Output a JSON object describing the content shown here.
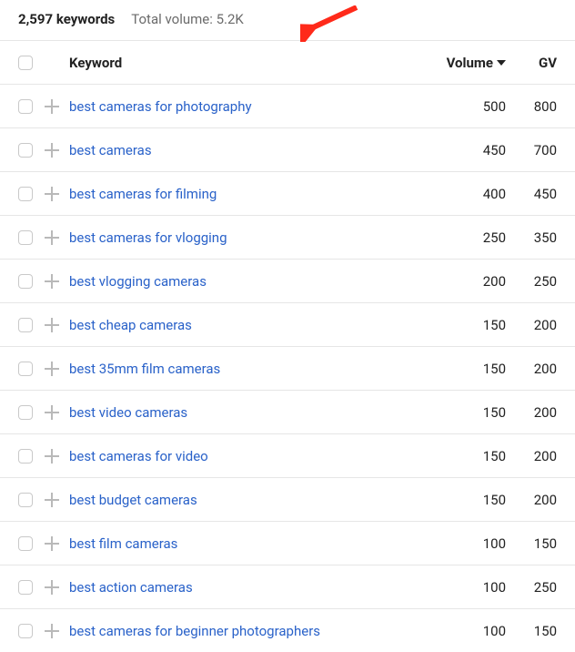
{
  "summary": {
    "keyword_count": "2,597 keywords",
    "total_volume": "Total volume: 5.2K"
  },
  "columns": {
    "keyword": "Keyword",
    "volume": "Volume",
    "gv": "GV"
  },
  "rows": [
    {
      "keyword": "best cameras for photography",
      "volume": "500",
      "gv": "800"
    },
    {
      "keyword": "best cameras",
      "volume": "450",
      "gv": "700"
    },
    {
      "keyword": "best cameras for filming",
      "volume": "400",
      "gv": "450"
    },
    {
      "keyword": "best cameras for vlogging",
      "volume": "250",
      "gv": "350"
    },
    {
      "keyword": "best vlogging cameras",
      "volume": "200",
      "gv": "250"
    },
    {
      "keyword": "best cheap cameras",
      "volume": "150",
      "gv": "200"
    },
    {
      "keyword": "best 35mm film cameras",
      "volume": "150",
      "gv": "200"
    },
    {
      "keyword": "best video cameras",
      "volume": "150",
      "gv": "200"
    },
    {
      "keyword": "best cameras for video",
      "volume": "150",
      "gv": "200"
    },
    {
      "keyword": "best budget cameras",
      "volume": "150",
      "gv": "200"
    },
    {
      "keyword": "best film cameras",
      "volume": "100",
      "gv": "150"
    },
    {
      "keyword": "best action cameras",
      "volume": "100",
      "gv": "250"
    },
    {
      "keyword": "best cameras for beginner photographers",
      "volume": "100",
      "gv": "150"
    }
  ]
}
